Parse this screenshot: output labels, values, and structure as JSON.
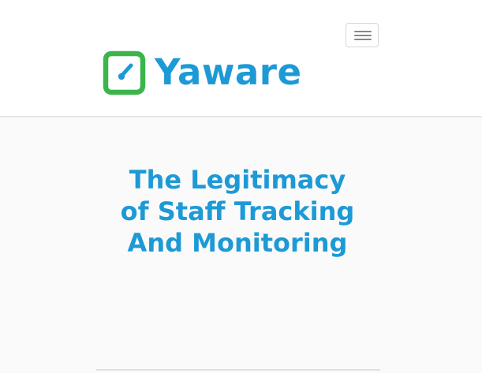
{
  "header": {
    "logo": {
      "text": "Yaware",
      "icon": "yaware-logo-icon",
      "mark_color": "#3bb54a",
      "text_color": "#1d9ad6"
    },
    "menu_toggle": {
      "icon": "hamburger-menu-icon"
    }
  },
  "main": {
    "title": "The Legitimacy of Staff Tracking And Monitoring",
    "title_color": "#1d9ad6"
  }
}
